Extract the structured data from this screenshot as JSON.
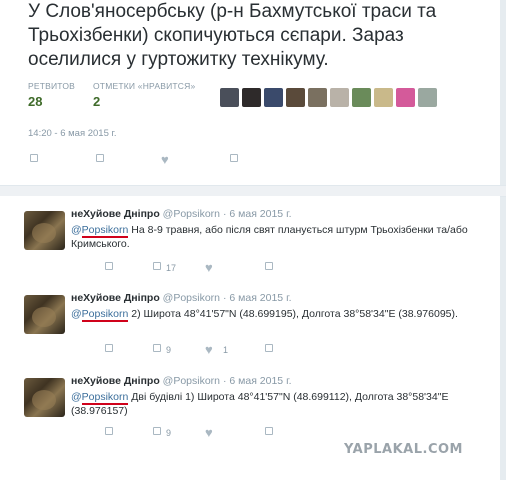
{
  "main_tweet": {
    "text": "У Слов'яносербську (р-н Бахмутської траси та Трьохізбенки) скопичуються сєпари. Зараз оселилися у гуртожитку технікуму.",
    "retweets_label": "РЕТВИТОВ",
    "retweets_count": "28",
    "likes_label": "ОТМЕТКИ «НРАВИТСЯ»",
    "likes_count": "2",
    "timestamp": "14:20 - 6 мая 2015 г.",
    "avatar_colors": [
      "#4a4f5a",
      "#2e2a2a",
      "#3a4a6b",
      "#5a4a3a",
      "#7a7060",
      "#b9b2a8",
      "#6a8b5a",
      "#c9b98a",
      "#d45a9a",
      "#9aa8a0"
    ]
  },
  "replies": [
    {
      "name": "неХуйове Дніпро",
      "handle": "@Popsikorn",
      "date": "6 мая 2015 г.",
      "mention": "Popsikorn",
      "text": " На 8-9 травня, або після свят планується штурм Трьохізбенки та/або Кримського.",
      "retweet_count": "17",
      "like_count": ""
    },
    {
      "name": "неХуйове Дніпро",
      "handle": "@Popsikorn",
      "date": "6 мая 2015 г.",
      "mention": "Popsikorn",
      "text": " 2) Широта 48°41'57\"N (48.699195), Долгота 38°58'34\"E (38.976095).",
      "retweet_count": "9",
      "like_count": "1"
    },
    {
      "name": "неХуйове Дніпро",
      "handle": "@Popsikorn",
      "date": "6 мая 2015 г.",
      "mention": "Popsikorn",
      "text": " Дві будівлі 1) Широта 48°41'57\"N (48.699112), Долгота 38°58'34\"E (38.976157)",
      "retweet_count": "9",
      "like_count": ""
    }
  ],
  "watermark": "YAPLAKAL.COM"
}
